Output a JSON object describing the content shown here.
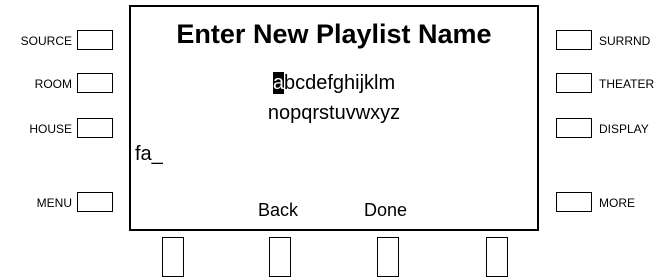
{
  "left_buttons": [
    {
      "label": "SOURCE"
    },
    {
      "label": "ROOM"
    },
    {
      "label": "HOUSE"
    },
    {
      "label": "MENU"
    }
  ],
  "right_buttons": [
    {
      "label": "SURRND"
    },
    {
      "label": "THEATER"
    },
    {
      "label": "DISPLAY"
    },
    {
      "label": "MORE"
    }
  ],
  "screen": {
    "title": "Enter New Playlist Name",
    "alphabet": {
      "selected_char": "a",
      "row1_rest": "bcdefghijklm",
      "row2": "nopqrstuvwxyz"
    },
    "entry_text": "fa_",
    "softkeys": {
      "back": "Back",
      "done": "Done"
    }
  }
}
